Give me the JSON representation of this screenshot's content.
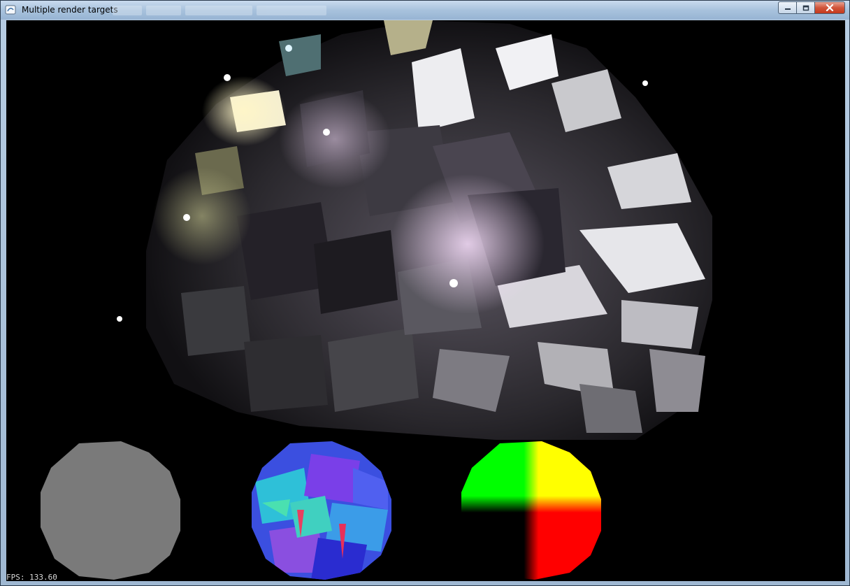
{
  "window": {
    "title": "Multiple render targets"
  },
  "overlay": {
    "fps_label": "FPS: 133.60"
  },
  "colors": {
    "titlebar": "#a8c2dd",
    "close_button": "#c5391c",
    "viewport_background": "#000000",
    "depth_buffer": "#7a7a7a",
    "fps_text": "#d8d8d8"
  },
  "icons": {
    "app": "app-icon",
    "minimize": "minimize-icon",
    "maximize": "maximize-icon",
    "close": "close-icon"
  }
}
